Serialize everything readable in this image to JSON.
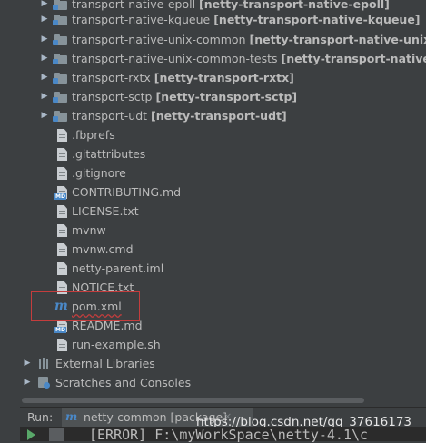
{
  "tree": {
    "modules": [
      {
        "name": "transport-native-epoll",
        "module": "[netty-transport-native-epoll]"
      },
      {
        "name": "transport-native-kqueue",
        "module": "[netty-transport-native-kqueue]"
      },
      {
        "name": "transport-native-unix-common",
        "module": "[netty-transport-native-unix-comm"
      },
      {
        "name": "transport-native-unix-common-tests",
        "module": "[netty-transport-native-unix-c"
      },
      {
        "name": "transport-rxtx",
        "module": "[netty-transport-rxtx]"
      },
      {
        "name": "transport-sctp",
        "module": "[netty-transport-sctp]"
      },
      {
        "name": "transport-udt",
        "module": "[netty-transport-udt]"
      }
    ],
    "files": [
      ".fbprefs",
      ".gitattributes",
      ".gitignore",
      "CONTRIBUTING.md",
      "LICENSE.txt",
      "mvnw",
      "mvnw.cmd",
      "netty-parent.iml",
      "NOTICE.txt",
      "pom.xml",
      "README.md",
      "run-example.sh"
    ],
    "external_libraries": "External Libraries",
    "scratches": "Scratches and Consoles"
  },
  "run": {
    "label": "Run:",
    "tab_label": "netty-common [package]",
    "close": "×"
  },
  "watermark": "https://blog.csdn.net/qq_37616173",
  "console": {
    "line": "[ERROR] F:\\myWorkSpace\\netty-4.1\\c"
  }
}
